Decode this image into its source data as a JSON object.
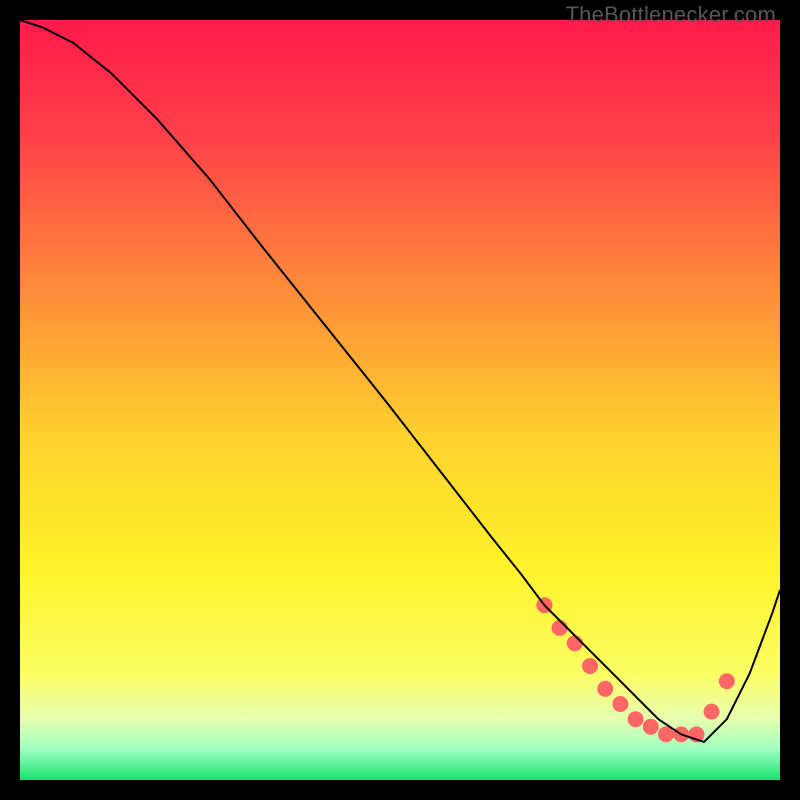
{
  "watermark": "TheBottlenecker.com",
  "chart_data": {
    "type": "line",
    "title": "",
    "xlabel": "",
    "ylabel": "",
    "xlim": [
      0,
      100
    ],
    "ylim": [
      0,
      100
    ],
    "grid": false,
    "background_gradient": {
      "type": "vertical",
      "stops": [
        {
          "offset": 0.0,
          "color": "#ff1a4b"
        },
        {
          "offset": 0.15,
          "color": "#ff3f49"
        },
        {
          "offset": 0.35,
          "color": "#ff8a3a"
        },
        {
          "offset": 0.55,
          "color": "#ffd22e"
        },
        {
          "offset": 0.72,
          "color": "#fff22a"
        },
        {
          "offset": 0.86,
          "color": "#fcff63"
        },
        {
          "offset": 0.92,
          "color": "#e6ffb0"
        },
        {
          "offset": 0.96,
          "color": "#9dffc0"
        },
        {
          "offset": 1.0,
          "color": "#17e36f"
        }
      ]
    },
    "series": [
      {
        "name": "bottleneck-curve",
        "color": "#000000",
        "stroke_width": 2,
        "x": [
          0,
          3,
          7,
          12,
          18,
          25,
          32,
          40,
          48,
          55,
          62,
          66,
          69,
          72,
          75,
          78,
          81,
          84,
          87,
          90,
          93,
          96,
          99,
          100
        ],
        "y": [
          100,
          99,
          97,
          93,
          87,
          79,
          70,
          60,
          50,
          41,
          32,
          27,
          23,
          20,
          17,
          14,
          11,
          8,
          6,
          5,
          8,
          14,
          22,
          25
        ]
      }
    ],
    "markers": {
      "name": "optimal-zone-dots",
      "color": "#ff6666",
      "radius": 8,
      "points": [
        {
          "x": 69,
          "y": 23
        },
        {
          "x": 71,
          "y": 20
        },
        {
          "x": 73,
          "y": 18
        },
        {
          "x": 75,
          "y": 15
        },
        {
          "x": 77,
          "y": 12
        },
        {
          "x": 79,
          "y": 10
        },
        {
          "x": 81,
          "y": 8
        },
        {
          "x": 83,
          "y": 7
        },
        {
          "x": 85,
          "y": 6
        },
        {
          "x": 87,
          "y": 6
        },
        {
          "x": 89,
          "y": 6
        },
        {
          "x": 91,
          "y": 9
        },
        {
          "x": 93,
          "y": 13
        }
      ]
    }
  }
}
